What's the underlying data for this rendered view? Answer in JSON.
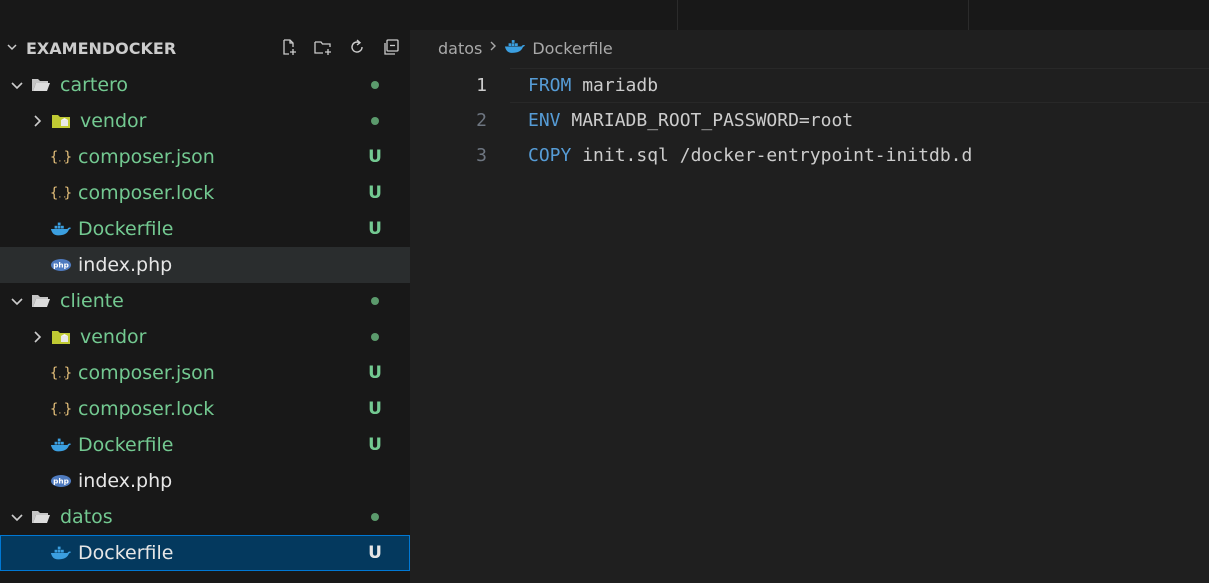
{
  "explorer": {
    "title": "EXAMENDOCKER",
    "actions": [
      {
        "name": "new-file-icon"
      },
      {
        "name": "new-folder-icon"
      },
      {
        "name": "refresh-icon"
      },
      {
        "name": "collapse-all-icon"
      }
    ],
    "items": [
      {
        "label": "cartero",
        "type": "folder",
        "depth": 0,
        "expanded": true,
        "status": "dot"
      },
      {
        "label": "vendor",
        "type": "vendor",
        "depth": 1,
        "expanded": false,
        "status": "dot"
      },
      {
        "label": "composer.json",
        "type": "json",
        "depth": 1,
        "status": "U"
      },
      {
        "label": "composer.lock",
        "type": "json",
        "depth": 1,
        "status": "U"
      },
      {
        "label": "Dockerfile",
        "type": "docker",
        "depth": 1,
        "status": "U"
      },
      {
        "label": "index.php",
        "type": "php",
        "depth": 1,
        "status": ""
      },
      {
        "label": "cliente",
        "type": "folder",
        "depth": 0,
        "expanded": true,
        "status": "dot"
      },
      {
        "label": "vendor",
        "type": "vendor",
        "depth": 1,
        "expanded": false,
        "status": "dot"
      },
      {
        "label": "composer.json",
        "type": "json",
        "depth": 1,
        "status": "U"
      },
      {
        "label": "composer.lock",
        "type": "json",
        "depth": 1,
        "status": "U"
      },
      {
        "label": "Dockerfile",
        "type": "docker",
        "depth": 1,
        "status": "U"
      },
      {
        "label": "index.php",
        "type": "php",
        "depth": 1,
        "status": ""
      },
      {
        "label": "datos",
        "type": "folder",
        "depth": 0,
        "expanded": true,
        "status": "dot"
      },
      {
        "label": "Dockerfile",
        "type": "docker",
        "depth": 1,
        "status": "U"
      }
    ]
  },
  "breadcrumb": {
    "folder": "datos",
    "file": "Dockerfile"
  },
  "editor": {
    "lines": [
      {
        "number": "1",
        "keyword": "FROM",
        "rest": " mariadb"
      },
      {
        "number": "2",
        "keyword": "ENV",
        "rest": " MARIADB_ROOT_PASSWORD=root"
      },
      {
        "number": "3",
        "keyword": "COPY",
        "rest": " init.sql /docker-entrypoint-initdb.d"
      }
    ]
  },
  "colors": {
    "untracked": "#73c991",
    "keyword": "#569cd6",
    "selection": "#04395e",
    "focus_border": "#0078d4"
  }
}
